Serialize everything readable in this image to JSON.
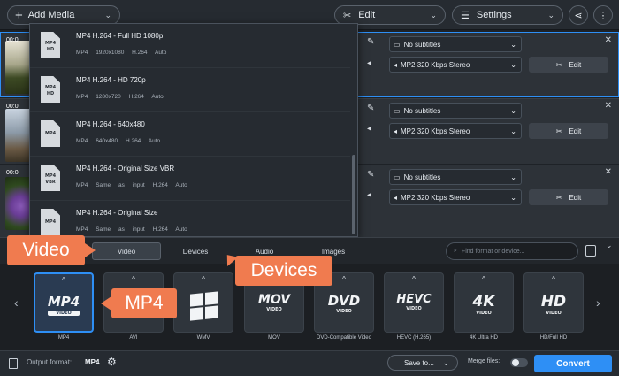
{
  "toolbar": {
    "add_media": "Add Media",
    "edit": "Edit",
    "settings": "Settings"
  },
  "rows": [
    {
      "duration": "00:0",
      "subtitles": "No subtitles",
      "audio": "MP2 320 Kbps Stereo",
      "edit": "Edit"
    },
    {
      "duration": "00:0",
      "subtitles": "No subtitles",
      "audio": "MP2 320 Kbps Stereo",
      "edit": "Edit"
    },
    {
      "duration": "00:0",
      "subtitles": "No subtitles",
      "audio": "MP2 320 Kbps Stereo",
      "edit": "Edit"
    }
  ],
  "presets": [
    {
      "name": "MP4 H.264 - Full HD 1080p",
      "format": "MP4",
      "resolution": "1920x1080",
      "codec": "H.264",
      "fps": "Auto",
      "badge": "HD"
    },
    {
      "name": "MP4 H.264 - HD 720p",
      "format": "MP4",
      "resolution": "1280x720",
      "codec": "H.264",
      "fps": "Auto",
      "badge": "HD"
    },
    {
      "name": "MP4 H.264 - 640x480",
      "format": "MP4",
      "resolution": "640x480",
      "codec": "H.264",
      "fps": "Auto",
      "badge": ""
    },
    {
      "name": "MP4 H.264 - Original Size VBR",
      "format": "MP4",
      "resolution": "Same as input",
      "codec": "H.264",
      "fps": "Auto",
      "badge": "VBR"
    },
    {
      "name": "MP4 H.264 - Original Size",
      "format": "MP4",
      "resolution": "Same as input",
      "codec": "H.264",
      "fps": "Auto",
      "badge": ""
    }
  ],
  "tabs": {
    "video": "Video",
    "devices": "Devices",
    "audio": "Audio",
    "images": "Images"
  },
  "search_placeholder": "Find format or device...",
  "formats": [
    {
      "logo": "MP4",
      "sub": "VIDEO",
      "label": "MP4"
    },
    {
      "logo": "",
      "sub": "",
      "label": "AVI"
    },
    {
      "logo": "",
      "sub": "",
      "label": "WMV"
    },
    {
      "logo": "MOV",
      "sub": "VIDEO",
      "label": "MOV"
    },
    {
      "logo": "DVD",
      "sub": "VIDEO",
      "label": "DVD-Compatible Video"
    },
    {
      "logo": "HEVC",
      "sub": "VIDEO",
      "label": "HEVC (H.265)"
    },
    {
      "logo": "4K",
      "sub": "VIDEO",
      "label": "4K Ultra HD"
    },
    {
      "logo": "HD",
      "sub": "VIDEO",
      "label": "HD/Full HD"
    }
  ],
  "bottom": {
    "output_label": "Output format:",
    "output_value": "MP4",
    "save_to": "Save to...",
    "merge": "Merge files:",
    "convert": "Convert"
  },
  "callouts": {
    "video": "Video",
    "devices": "Devices",
    "mp4": "MP4"
  },
  "colors": {
    "accent": "#2e8ff5",
    "callout": "#f07b4f"
  }
}
